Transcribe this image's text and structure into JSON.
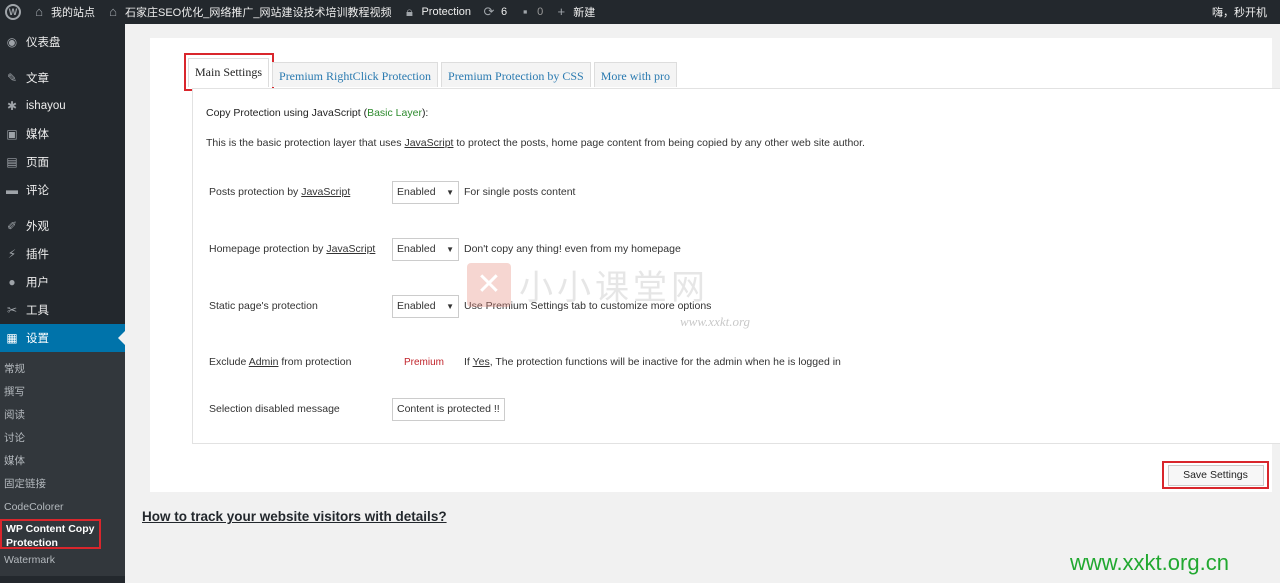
{
  "adminbar": {
    "site_name": "我的站点",
    "site_title": "石家庄SEO优化_网络推广_网站建设技术培训教程视频",
    "protection": "Protection",
    "updates_count": "6",
    "comments_count": "0",
    "new_label": "新建",
    "greeting": "嗨，秒开机"
  },
  "sidebar": {
    "items": [
      {
        "label": "仪表盘",
        "icon": "dashboard-icon"
      },
      {
        "label": "文章",
        "icon": "pin-icon"
      },
      {
        "label": "ishayou",
        "icon": "gear-icon"
      },
      {
        "label": "媒体",
        "icon": "media-icon"
      },
      {
        "label": "页面",
        "icon": "page-icon"
      },
      {
        "label": "评论",
        "icon": "comment-icon"
      },
      {
        "label": "外观",
        "icon": "brush-icon"
      },
      {
        "label": "插件",
        "icon": "plugin-icon"
      },
      {
        "label": "用户",
        "icon": "user-icon"
      },
      {
        "label": "工具",
        "icon": "wrench-icon"
      },
      {
        "label": "设置",
        "icon": "settings-icon"
      }
    ],
    "submenu": [
      "常规",
      "撰写",
      "阅读",
      "讨论",
      "媒体",
      "固定链接",
      "CodeColorer",
      "WP Content Copy Protection",
      "Watermark"
    ]
  },
  "tabs": [
    "Main Settings",
    "Premium RightClick Protection",
    "Premium Protection by CSS",
    "More with pro"
  ],
  "box": {
    "heading_prefix": "Copy Protection using JavaScript (",
    "heading_green": "Basic Layer",
    "heading_suffix": "):",
    "desc_prefix": "This is the basic protection layer that uses ",
    "desc_link": "JavaScript",
    "desc_suffix": " to protect the posts, home page content from being copied by any other web site author."
  },
  "rows": {
    "posts": {
      "label_prefix": "Posts protection by ",
      "label_link": "JavaScript",
      "value": "Enabled",
      "note": "For single posts content"
    },
    "homepage": {
      "label_prefix": "Homepage protection by ",
      "label_link": "JavaScript",
      "value": "Enabled",
      "note": "Don't copy any thing! even from my homepage"
    },
    "static": {
      "label": "Static page's protection",
      "value": "Enabled",
      "note": "Use Premium Settings tab to customize more options"
    },
    "exclude": {
      "label_prefix": "Exclude ",
      "label_link": "Admin",
      "label_suffix": " from protection",
      "premium": "Premium",
      "note_prefix": "If ",
      "note_link": "Yes",
      "note_suffix": ", The protection functions will be inactive for the admin when he is logged in"
    },
    "selection": {
      "label": "Selection disabled message",
      "value": "Content is protected !!"
    }
  },
  "save_label": "Save Settings",
  "track_link": "How to track your website visitors with details?",
  "watermark": {
    "text": "小小课堂网",
    "sub": "www.xxkt.org",
    "url": "www.xxkt.org.cn"
  }
}
